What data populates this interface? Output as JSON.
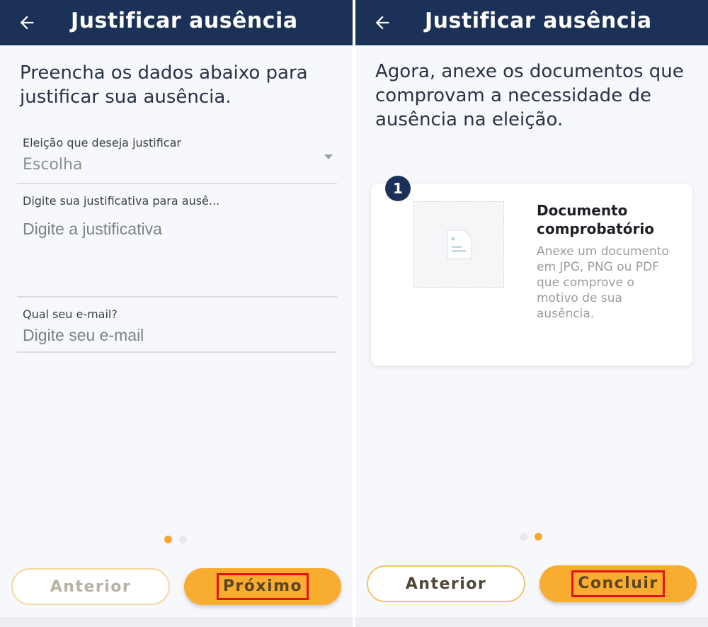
{
  "step1": {
    "header": {
      "title": "Justificar ausência"
    },
    "intro": "Preencha os dados abaixo para justificar sua ausência.",
    "election_field": {
      "label": "Eleição que deseja justificar",
      "value": "Escolha"
    },
    "justification_field": {
      "label": "Digite sua justificativa para ausê...",
      "placeholder": "Digite a justificativa"
    },
    "email_field": {
      "label": "Qual seu e-mail?",
      "placeholder": "Digite seu e-mail"
    },
    "pagination": {
      "current": 1,
      "total": 2
    },
    "buttons": {
      "previous": "Anterior",
      "next": "Próximo"
    }
  },
  "step2": {
    "header": {
      "title": "Justificar ausência"
    },
    "intro": "Agora, anexe os documentos que comprovam a necessidade de ausência na eleição.",
    "document_card": {
      "badge": "1",
      "title": "Documento comprobatório",
      "description": "Anexe um documento em JPG, PNG ou PDF que comprove o motivo de sua ausência."
    },
    "pagination": {
      "current": 2,
      "total": 2
    },
    "buttons": {
      "previous": "Anterior",
      "finish": "Concluir"
    }
  },
  "colors": {
    "header_bg": "#1b3158",
    "accent": "#f8ac30",
    "highlight": "#e5121b",
    "background": "#f7f8fc"
  },
  "icons": [
    "back-arrow-icon",
    "dropdown-caret-icon",
    "document-icon"
  ]
}
